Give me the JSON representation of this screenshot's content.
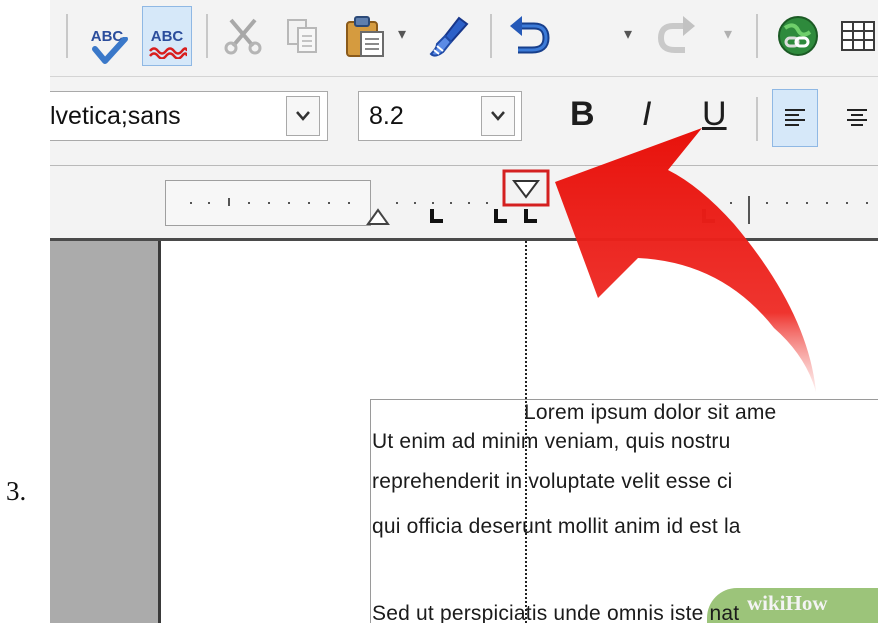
{
  "step": {
    "number": "3."
  },
  "toolbar": {
    "spellcheck_label": "ABC",
    "autospell_label": "ABC"
  },
  "formatting": {
    "font_name": "lvetica;sans",
    "font_size": "8.2",
    "bold_label": "B",
    "italic_label": "I",
    "underline_label": "U"
  },
  "document": {
    "lines": [
      "Lorem ipsum dolor sit ame",
      "Ut enim ad minim veniam, quis nostru",
      "reprehenderit in voluptate velit esse ci",
      "qui officia deserunt mollit anim id est la",
      "Sed ut perspiciatis unde omnis iste nat"
    ]
  },
  "watermark": {
    "text": "wikiHow"
  },
  "colors": {
    "arrow": "#e8120c",
    "highlight_box": "#d42020",
    "active_button": "#d6e8f9"
  }
}
